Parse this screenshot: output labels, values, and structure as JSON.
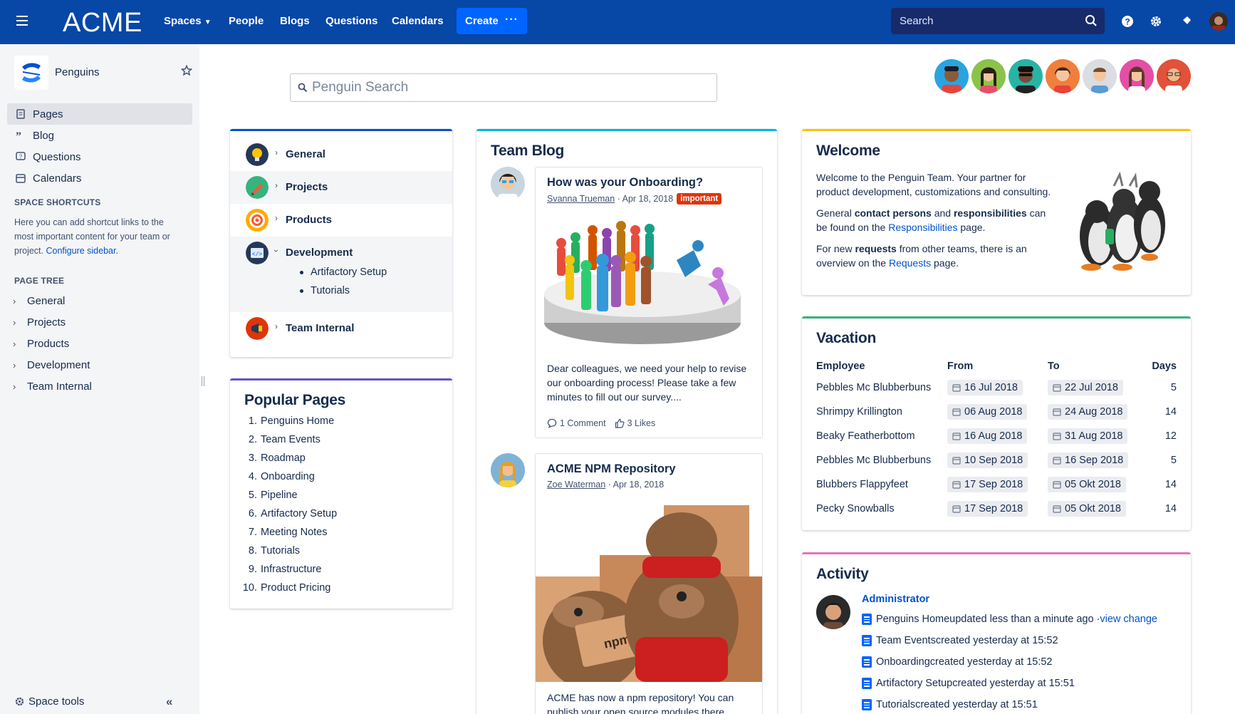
{
  "topnav": {
    "logo": "ACME",
    "items": [
      "Spaces",
      "People",
      "Blogs",
      "Questions",
      "Calendars"
    ],
    "create_label": "Create",
    "more_label": "···",
    "search_placeholder": "Search",
    "colors": {
      "bar": "#0747A6",
      "create": "#0065FF"
    }
  },
  "sidebar": {
    "space_name": "Penguins",
    "nav": [
      "Pages",
      "Blog",
      "Questions",
      "Calendars"
    ],
    "shortcuts_title": "SPACE SHORTCUTS",
    "shortcuts_text": "Here you can add shortcut links to the most important content for your team or project.",
    "shortcuts_link": "Configure sidebar",
    "shortcuts_end": ".",
    "tree_title": "PAGE TREE",
    "tree": [
      "General",
      "Projects",
      "Products",
      "Development",
      "Team Internal"
    ],
    "tools": "Space tools",
    "collapse": "«"
  },
  "main": {
    "penguin_search": "Penguin Search",
    "categories": [
      {
        "label": "General",
        "icon": "lightbulb-icon"
      },
      {
        "label": "Projects",
        "icon": "pencil-icon"
      },
      {
        "label": "Products",
        "icon": "target-icon"
      },
      {
        "label": "Development",
        "icon": "code-icon",
        "children": [
          "Artifactory Setup",
          "Tutorials"
        ]
      },
      {
        "label": "Team Internal",
        "icon": "megaphone-icon"
      }
    ],
    "popular": {
      "title": "Popular Pages",
      "items": [
        "Penguins Home",
        "Team Events",
        "Roadmap",
        "Onboarding",
        "Pipeline",
        "Artifactory Setup",
        "Meeting Notes",
        "Tutorials",
        "Infrastructure",
        "Product Pricing"
      ],
      "numbers": [
        "1.",
        "2.",
        "3.",
        "4.",
        "5.",
        "6.",
        "7.",
        "8.",
        "9.",
        "10."
      ]
    },
    "blog": {
      "title": "Team Blog",
      "posts": [
        {
          "title": "How was your Onboarding?",
          "author": "Svanna Trueman",
          "date": "· Apr 18, 2018",
          "label": "important",
          "body": "Dear colleagues, we need your help to revise our onboarding process! Please take a few minutes to fill out our survey....",
          "comments": "1 Comment",
          "likes": "3 Likes"
        },
        {
          "title": "ACME NPM Repository",
          "author": "Zoe Waterman",
          "date": "· Apr 18, 2018",
          "body": "ACME has now a npm repository! You can publish your open source modules there"
        }
      ]
    },
    "welcome": {
      "title": "Welcome",
      "p1": "Welcome to the Penguin Team. Your partner for product development, customizations and consulting.",
      "p2a": "General ",
      "p2b": "contact persons",
      "p2c": " and ",
      "p2d": "responsibilities",
      "p2e": " can be found on the ",
      "p2link": "Responsibilities",
      "p2f": " page.",
      "p3a": "For new ",
      "p3b": "requests",
      "p3c": " from other teams, there is an overview on the ",
      "p3link": "Requests",
      "p3d": " page."
    },
    "vacation": {
      "title": "Vacation",
      "headers": [
        "Employee",
        "From",
        "To",
        "Days"
      ],
      "rows": [
        {
          "employee": "Pebbles Mc Blubberbuns",
          "from": "16 Jul 2018",
          "to": "22 Jul 2018",
          "days": "5"
        },
        {
          "employee": "Shrimpy Krillington",
          "from": "06 Aug 2018",
          "to": "24 Aug 2018",
          "days": "14"
        },
        {
          "employee": "Beaky Featherbottom",
          "from": "16 Aug 2018",
          "to": "31 Aug 2018",
          "days": "12"
        },
        {
          "employee": "Pebbles Mc Blubberbuns",
          "from": "10 Sep 2018",
          "to": "16 Sep 2018",
          "days": "5"
        },
        {
          "employee": "Blubbers Flappyfeet",
          "from": "17 Sep 2018",
          "to": "05 Okt 2018",
          "days": "14"
        },
        {
          "employee": "Pecky Snowballs",
          "from": "17 Sep 2018",
          "to": "05 Okt 2018",
          "days": "14"
        }
      ]
    },
    "activity": {
      "title": "Activity",
      "user": "Administrator",
      "items": [
        {
          "page": "Penguins Home",
          "text": " updated less than a minute ago · ",
          "link": "view change"
        },
        {
          "page": "Team Events",
          "text": " created yesterday at 15:52"
        },
        {
          "page": "Onboarding",
          "text": " created yesterday at 15:52"
        },
        {
          "page": "Artifactory Setup",
          "text": " created yesterday at 15:51"
        },
        {
          "page": "Tutorials",
          "text": " created yesterday at 15:51"
        }
      ]
    }
  }
}
